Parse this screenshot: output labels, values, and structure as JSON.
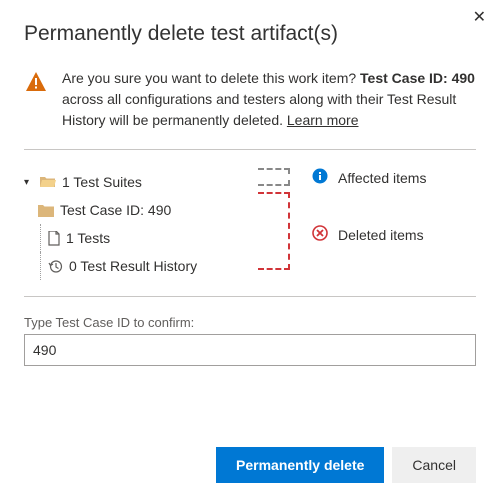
{
  "dialog": {
    "title": "Permanently delete test artifact(s)",
    "close": "✕"
  },
  "warning": {
    "prefix": "Are you sure you want to delete this work item? ",
    "bold": "Test Case ID: 490",
    "suffix": " across all configurations and testers along with their Test Result History will be permanently deleted. ",
    "learn_more": "Learn more"
  },
  "tree": {
    "suites": "1 Test Suites",
    "testcase": "Test Case ID: 490",
    "tests": "1 Tests",
    "history": "0 Test Result History"
  },
  "legend": {
    "affected": "Affected items",
    "deleted": "Deleted items"
  },
  "confirm": {
    "label": "Type Test Case ID to confirm:",
    "value": "490"
  },
  "buttons": {
    "primary": "Permanently delete",
    "cancel": "Cancel"
  },
  "colors": {
    "primary": "#0078d4",
    "danger": "#d13438",
    "warn": "#d96b0b",
    "info": "#0078d4"
  }
}
